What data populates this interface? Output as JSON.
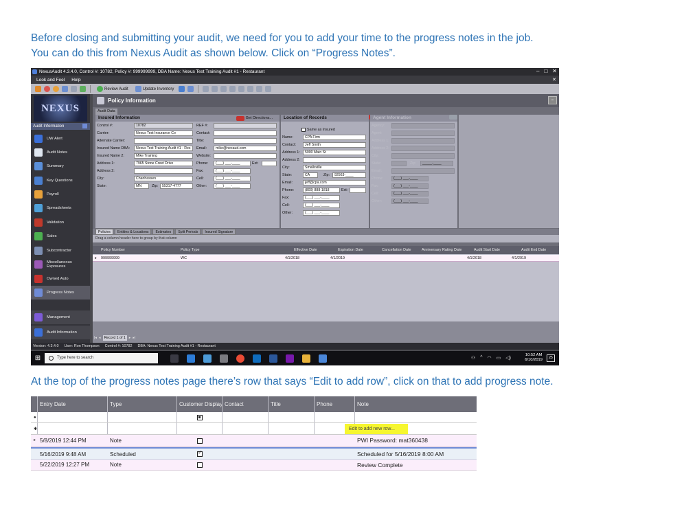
{
  "doc": {
    "intro_line1": "Before closing and submitting your audit, we need for you to add your time to the progress notes in the job.",
    "intro_line2": "You can do this from Nexus Audit as shown below. Click on “Progress Notes”.",
    "mid_line": "At the top of the progress notes page there’s row that says “Edit to add row”, click on that to add progress note."
  },
  "app": {
    "title": "NexusAudit 4.3.4.0, Control #: 10782, Policy #: 999999999, DBA Name: Nexus Test Training Audit #1 - Restaurant",
    "window_controls": [
      "–",
      "□",
      "✕"
    ],
    "menu": [
      "Look and Feel",
      "Help"
    ],
    "menu_close": "✕",
    "toolbar": {
      "review_audit": "Review Audit",
      "update_inventory": "Update Inventory"
    },
    "logo_text": "NEXUS",
    "sidebar": {
      "header": "Audit Information",
      "items": [
        {
          "label": "UW Alert",
          "color": "#3b6fd8"
        },
        {
          "label": "Audit Notes",
          "color": "#dfe6f0"
        },
        {
          "label": "Summary",
          "color": "#5a8fd9"
        },
        {
          "label": "Key Questions",
          "color": "#4a7fd0"
        },
        {
          "label": "Payroll",
          "color": "#e8a13a"
        },
        {
          "label": "Spreadsheets",
          "color": "#4fa0d8"
        },
        {
          "label": "Validation",
          "color": "#c0392b"
        },
        {
          "label": "Sales",
          "color": "#4caf50"
        },
        {
          "label": "Subcontractor",
          "color": "#7d8fb3"
        },
        {
          "label": "Miscellaneous Exposures",
          "color": "#9b59b6"
        },
        {
          "label": "Owned Auto",
          "color": "#c7322e"
        },
        {
          "label": "Progress Notes",
          "color": "#6f8bd6"
        }
      ],
      "bottom_items": [
        {
          "label": "Management",
          "color": "#7d5bd6"
        },
        {
          "label": "Audit Information",
          "color": "#3b6fd8"
        }
      ]
    },
    "panel_title": "Policy Information",
    "panel_collapse": "–",
    "audit_data_tab": "Audit Data",
    "insured": {
      "title": "Insured Information",
      "directions": "Get Directions...",
      "control_label": "Control #:",
      "control": "10782",
      "carrier_label": "Carrier:",
      "carrier": "Nexus Test Insurance Co",
      "alt_carrier_label": "Alternate Carrier:",
      "insured_dba_label": "Insured Name DBA:",
      "insured_dba": "Nexus Test Training Audit #1 - Res",
      "insured_name2_label": "Insured Name 2:",
      "insured_name2": "Mike Training",
      "addr1_label": "Address 1:",
      "addr1": "7965 Stone Creet Drive",
      "addr2_label": "Address 2:",
      "city_label": "City:",
      "city": "Chanhassen",
      "state_label": "State:",
      "state": "MN",
      "zip_label": "Zip:",
      "zip": "55317-4777",
      "ref_label": "REF #:",
      "contact_label": "Contact:",
      "title_label": "Title:",
      "email_label": "Email:",
      "email": "mike@nexaud.com",
      "website_label": "Website:",
      "phone_label": "Phone:",
      "phone": "(___) ___-____",
      "ext_label": "Ext:",
      "fax_label": "Fax:",
      "fax": "(___) ___-____",
      "cell_label": "Cell:",
      "cell": "(___) ___-____",
      "other_label": "Other:",
      "other": "(___) ___-____"
    },
    "records": {
      "title": "Location of Records",
      "same_as_insured": "Same as Insured",
      "name_label": "Name:",
      "name": "CPA Firm",
      "contact_label": "Contact:",
      "contact": "Jeff Smith",
      "addr1_label": "Address 1:",
      "addr1": "5000 Main St",
      "addr2_label": "Address 2:",
      "city_label": "City:",
      "city": "Smallsville",
      "state_label": "State:",
      "state": "CA",
      "zip_label": "Zip:",
      "zip": "92563-____",
      "email_label": "Email:",
      "email": "jeff@cpa.com",
      "phone_label": "Phone:",
      "phone": "(800) 888-1818",
      "ext_label": "Ext:",
      "fax_label": "Fax:",
      "fax": "(___) ___-____",
      "cell_label": "Cell:",
      "cell": "(___) ___-____",
      "other_label": "Other:",
      "other": "(___) ___-____"
    },
    "agent": {
      "title": "Agent Information",
      "agency_label": "Agency:",
      "agent_label": "Agent:",
      "addr1_label": "Address 1:",
      "addr2_label": "Address 2:",
      "city_label": "City:",
      "state_label": "State:",
      "zip_label": "Zip:",
      "zip": "_____-____",
      "email_label": "Email:",
      "phone_label": "Phone:",
      "fax_label": "Fax:",
      "cell_label": "Cell:",
      "other_label": "Other:",
      "phone": "(___) ___-____"
    },
    "sub_tabs": [
      "Policies",
      "Entities & Locations",
      "Estimates",
      "Split Periods",
      "Insured Signature"
    ],
    "group_by": "Drag a column header here to group by that column",
    "policy_grid": {
      "columns": [
        "Policy Number",
        "Policy Type",
        "Effective Date",
        "Expiration Date",
        "Cancellation Date",
        "Anniversary Rating Date",
        "Audit Start Date",
        "Audit End Date"
      ],
      "row": [
        "999999999",
        "WC",
        "4/1/2018",
        "4/1/2019",
        "",
        "",
        "4/1/2018",
        "4/1/2019"
      ]
    },
    "record_nav": "Record 1 of 1",
    "status": {
      "version": "Version: 4.3.4.0",
      "user": "User: Ron Thompson",
      "control": "Control #: 10782",
      "dba": "DBA: Nexus Test Training Audit #1 - Restaurant"
    },
    "taskbar": {
      "search_placeholder": "Type here to search",
      "time": "10:52 AM",
      "date": "6/10/2019",
      "notifications": "25"
    }
  },
  "progress_notes": {
    "columns": [
      "Entry Date",
      "Type",
      "Customer Display",
      "Contact",
      "Title",
      "Phone",
      "Note"
    ],
    "edit_hint": "Edit to add new row...",
    "rows": [
      {
        "entry_date": "5/8/2019 12:44 PM",
        "type": "Note",
        "customer_display": false,
        "note": "PWI Password: mat360438"
      },
      {
        "entry_date": "5/16/2019 9:48 AM",
        "type": "Scheduled",
        "customer_display": true,
        "note": "Scheduled for 5/16/2019 8:00 AM"
      },
      {
        "entry_date": "5/22/2019 12:27 PM",
        "type": "Note",
        "customer_display": false,
        "note": "Review Complete"
      }
    ]
  }
}
